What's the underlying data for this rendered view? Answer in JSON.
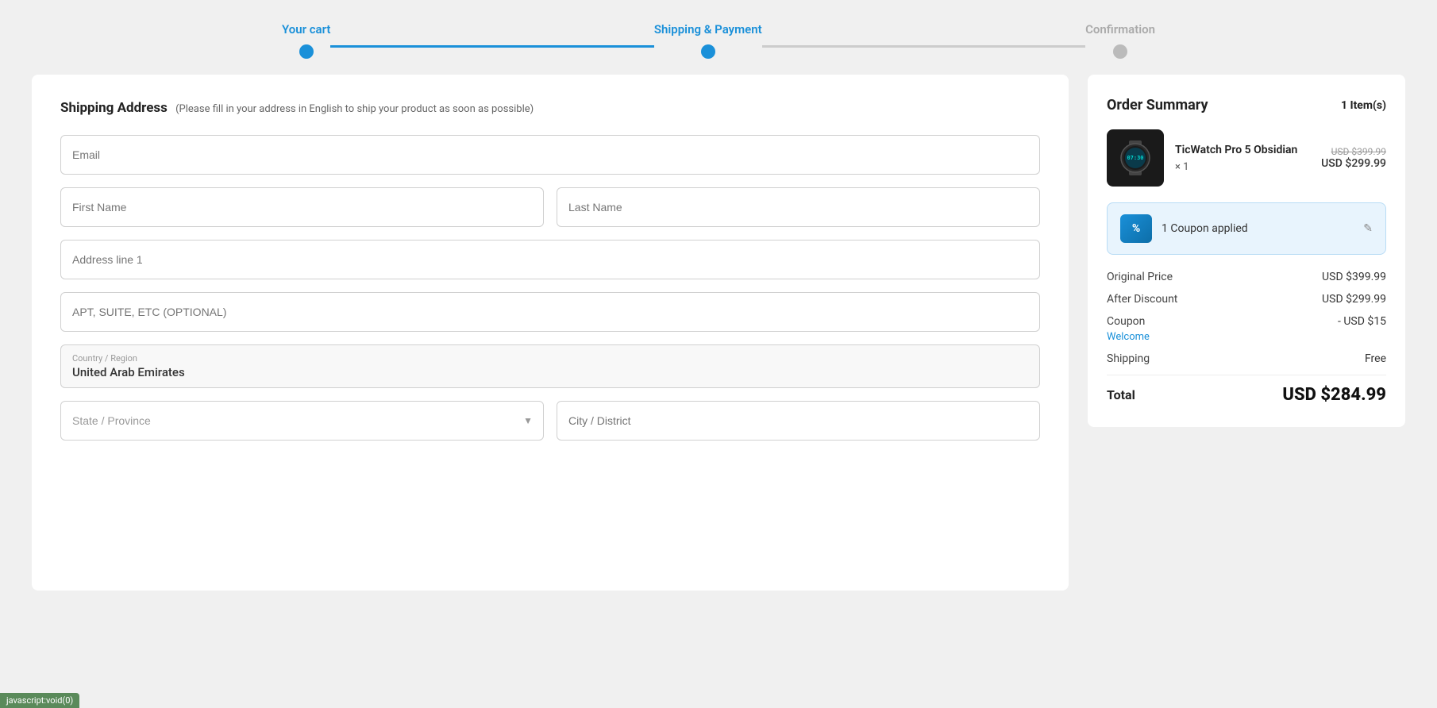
{
  "steps": [
    {
      "label": "Your cart",
      "state": "active",
      "dot": "active"
    },
    {
      "label": "Shipping & Payment",
      "state": "active",
      "dot": "active"
    },
    {
      "label": "Confirmation",
      "state": "inactive",
      "dot": "inactive"
    }
  ],
  "form": {
    "title": "Shipping Address",
    "subtitle": "(Please fill in your address in English to ship your product as soon as possible)",
    "email_placeholder": "Email",
    "first_name_placeholder": "First Name",
    "last_name_placeholder": "Last Name",
    "address1_placeholder": "Address line 1",
    "address2_placeholder": "APT, SUITE, ETC (OPTIONAL)",
    "country_label": "Country / Region",
    "country_value": "United Arab Emirates",
    "state_placeholder": "State / Province",
    "city_placeholder": "City / District"
  },
  "order_summary": {
    "title": "Order Summary",
    "item_count_label": "Item(s)",
    "item_count": "1",
    "product": {
      "name": "TicWatch Pro 5 Obsidian",
      "qty": "× 1",
      "original_price": "USD $399.99",
      "current_price": "USD $299.99"
    },
    "coupon": {
      "applied_text": "1 Coupon applied",
      "icon_text": "%"
    },
    "original_price_label": "Original Price",
    "original_price_value": "USD $399.99",
    "after_discount_label": "After Discount",
    "after_discount_value": "USD $299.99",
    "coupon_label": "Coupon",
    "coupon_value": "- USD $15",
    "coupon_name": "Welcome",
    "shipping_label": "Shipping",
    "shipping_value": "Free",
    "total_label": "Total",
    "total_value": "USD $284.99"
  },
  "js_status": "javascript:void(0)"
}
